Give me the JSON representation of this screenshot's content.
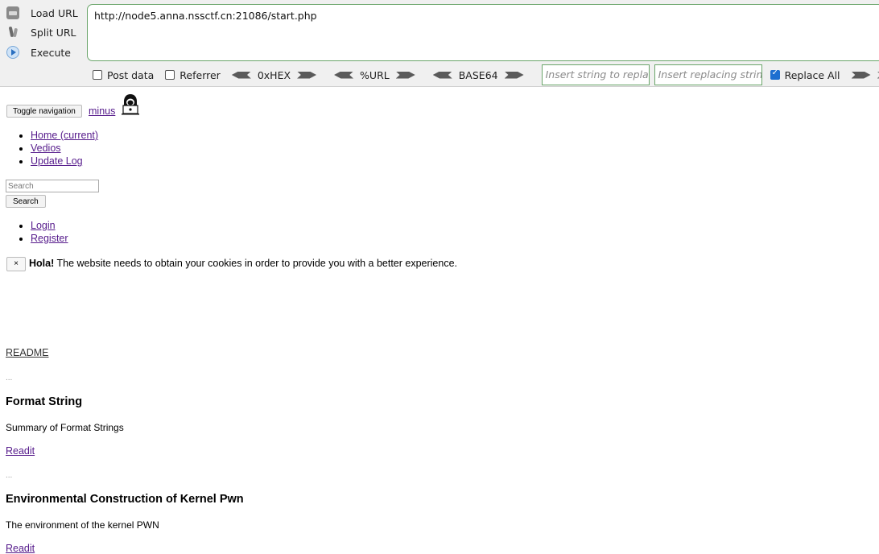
{
  "hackbar": {
    "load_label": "Load URL",
    "split_label": "Split URL",
    "execute_label": "Execute",
    "url": "http://node5.anna.nssctf.cn:21086/start.php",
    "post_data": "Post data",
    "referrer": "Referrer",
    "hex": "0xHEX",
    "urlenc": "%URL",
    "base64": "BASE64",
    "find_placeholder": "Insert string to replace",
    "replace_placeholder": "Insert replacing string",
    "replace_all": "Replace All"
  },
  "navbar": {
    "toggle": "Toggle navigation",
    "brand": "minus",
    "links": [
      "Home (current)",
      "Vedios",
      "Update Log"
    ],
    "search_placeholder": "Search",
    "search_button": "Search",
    "auth": [
      "Login",
      "Register"
    ]
  },
  "cookie": {
    "close": "×",
    "bold": "Hola!",
    "text": " The website needs to obtain your cookies in order to provide you with a better experience."
  },
  "content": {
    "readme": "README",
    "ellipsis": "...",
    "posts": [
      {
        "title": "Format String",
        "summary": "Summary of Format Strings",
        "link": "Readit"
      },
      {
        "title": "Environmental Construction of Kernel Pwn",
        "summary": "The environment of the kernel PWN",
        "link": "Readit"
      }
    ]
  }
}
